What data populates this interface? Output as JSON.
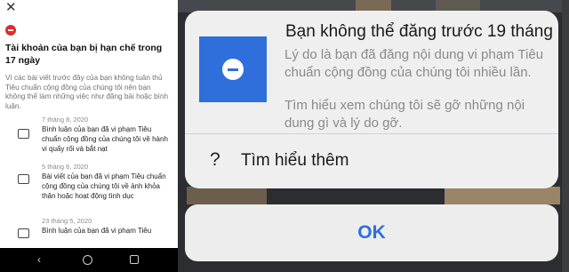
{
  "left_panel": {
    "close_glyph": "✕",
    "icon": "ban-icon",
    "title": "Tài khoản của bạn bị hạn chế trong 17 ngày",
    "description": "Vì các bài viết trước đây của bạn không tuân thủ Tiêu chuẩn cộng đồng của chúng tôi nên bạn không thể làm những việc như đăng bài hoặc bình luận.",
    "items": [
      {
        "date": "7 tháng 8, 2020",
        "text": "Bình luận của bạn đã vi phạm Tiêu chuẩn cộng đồng của chúng tôi về hành vi quấy rối và bắt nạt",
        "icon": "comment-icon"
      },
      {
        "date": "5 tháng 6, 2020",
        "text": "Bài viết của bạn đã vi phạm Tiêu chuẩn cộng đồng của chúng tôi về ảnh khỏa thân hoặc hoạt động tình dục",
        "icon": "post-icon"
      },
      {
        "date": "23 tháng 5, 2020",
        "text": "Bình luận của bạn đã vi phạm Tiêu",
        "icon": "comment-icon"
      }
    ],
    "navbar": {
      "back": "back-icon",
      "home": "home-icon",
      "recent": "recent-apps-icon"
    }
  },
  "dialog": {
    "icon": "restricted-icon",
    "heading": "Bạn không thể đăng trước 19 tháng 9",
    "reason": "Lý do là bạn đã đăng nội dung vi phạm Tiêu chuẩn cộng đồng của chúng tôi nhiều lần.",
    "learn_more_hint": "Tìm hiểu xem chúng tôi sẽ gỡ những nội dung gì và lý do gỡ.",
    "learn_more_glyph": "?",
    "learn_more_label": "Tìm hiểu thêm",
    "ok_label": "OK"
  },
  "colors": {
    "accent_blue": "#2f6fdc",
    "ban_red": "#e02d2d"
  }
}
